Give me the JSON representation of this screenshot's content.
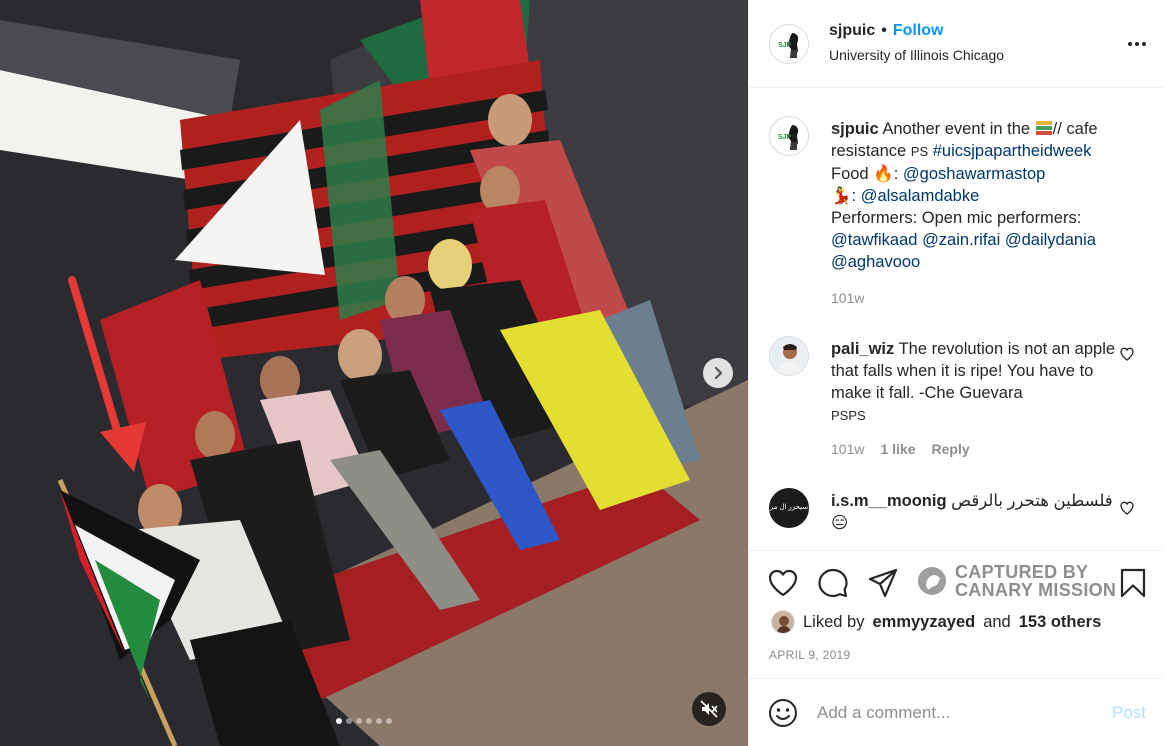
{
  "post": {
    "username": "sjpuic",
    "follow_label": "Follow",
    "separator": "•",
    "location": "University of Illinois Chicago",
    "more_label": "More options"
  },
  "caption": {
    "username": "sjpuic",
    "text_1": "Another event in the ",
    "text_2": "// cafe resistance ",
    "ps": "PS",
    "hashtag": "#uicsjpapartheidweek",
    "food_label": "Food ",
    "food_emoji": "🔥",
    "food_colon": ": ",
    "mention_food": "@goshawarmastop",
    "dance_emoji": "💃",
    "dance_colon": ": ",
    "mention_dance": "@alsalamdabke",
    "performers": "Performers: Open mic performers:",
    "mention_1": "@tawfikaad",
    "mention_2": "@zain.rifai",
    "mention_3": "@dailydania",
    "mention_4": "@aghavooo",
    "time": "101w"
  },
  "comments": [
    {
      "username": "pali_wiz",
      "text": "The revolution is not an apple that falls when it is ripe! You have to make it fall. -Che Guevara",
      "extra": "PSPS",
      "time": "101w",
      "likes": "1 like",
      "reply": "Reply"
    },
    {
      "username": "i.s.m__moonig",
      "text": "فلسطين هتحرر بالرقص",
      "emoji": "😑",
      "avatar_text": "سيحرر ال مز"
    }
  ],
  "watermark": {
    "line1": "CAPTURED BY",
    "line2": "CANARY MISSION"
  },
  "likes": {
    "prefix": "Liked by",
    "user": "emmyyzayed",
    "and": "and",
    "others": "153 others"
  },
  "date": "APRIL 9, 2019",
  "composer": {
    "placeholder": "Add a comment...",
    "post_label": "Post"
  },
  "media": {
    "slides_total": 6,
    "slide_active": 1
  },
  "colors": {
    "link": "#00376b",
    "follow": "#0095f6",
    "muted": "#8e8e8e",
    "post_disabled": "#b2dffc",
    "annotation_arrow": "#e53935"
  }
}
